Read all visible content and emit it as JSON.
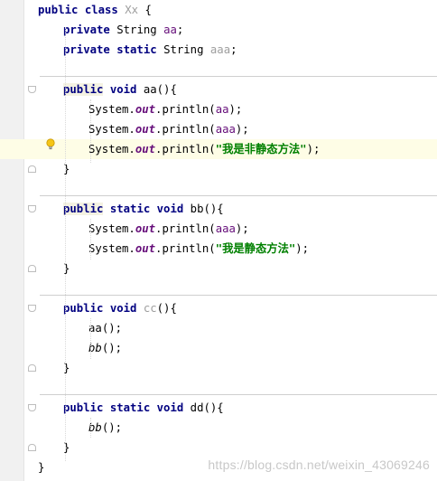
{
  "editor": {
    "lines": [
      {
        "kind": "code",
        "indent": 0,
        "tokens": [
          {
            "t": "public class ",
            "c": "kw"
          },
          {
            "t": "Xx",
            "c": "field-unused"
          },
          {
            "t": " {",
            "c": ""
          }
        ]
      },
      {
        "kind": "code",
        "indent": 1,
        "tokens": [
          {
            "t": "private ",
            "c": "kw"
          },
          {
            "t": "String ",
            "c": ""
          },
          {
            "t": "aa",
            "c": "field"
          },
          {
            "t": ";",
            "c": ""
          }
        ]
      },
      {
        "kind": "code",
        "indent": 1,
        "tokens": [
          {
            "t": "private static ",
            "c": "kw"
          },
          {
            "t": "String ",
            "c": ""
          },
          {
            "t": "aaa",
            "c": "field-unused"
          },
          {
            "t": ";",
            "c": ""
          }
        ]
      },
      {
        "kind": "blank"
      },
      {
        "kind": "code",
        "indent": 1,
        "fold": "start",
        "tokens": [
          {
            "t": "public",
            "c": "kw kwbg"
          },
          {
            "t": " void ",
            "c": "kw"
          },
          {
            "t": "aa",
            "c": ""
          },
          {
            "t": "(){",
            "c": ""
          }
        ]
      },
      {
        "kind": "code",
        "indent": 2,
        "tokens": [
          {
            "t": "System.",
            "c": ""
          },
          {
            "t": "out",
            "c": "static-field"
          },
          {
            "t": ".println(",
            "c": ""
          },
          {
            "t": "aa",
            "c": "field"
          },
          {
            "t": ");",
            "c": ""
          }
        ]
      },
      {
        "kind": "code",
        "indent": 2,
        "tokens": [
          {
            "t": "System.",
            "c": ""
          },
          {
            "t": "out",
            "c": "static-field"
          },
          {
            "t": ".println(",
            "c": ""
          },
          {
            "t": "aaa",
            "c": "field"
          },
          {
            "t": ");",
            "c": ""
          }
        ]
      },
      {
        "kind": "code",
        "indent": 2,
        "highlight": true,
        "bulb": true,
        "tokens": [
          {
            "t": "System.",
            "c": ""
          },
          {
            "t": "out",
            "c": "static-field"
          },
          {
            "t": ".println(",
            "c": ""
          },
          {
            "t": "\"我是非静态方法\"",
            "c": "str"
          },
          {
            "t": ");",
            "c": ""
          }
        ]
      },
      {
        "kind": "code",
        "indent": 1,
        "fold": "end",
        "tokens": [
          {
            "t": "}",
            "c": ""
          }
        ]
      },
      {
        "kind": "blank"
      },
      {
        "kind": "code",
        "indent": 1,
        "fold": "start",
        "tokens": [
          {
            "t": "public",
            "c": "kw kwbg"
          },
          {
            "t": " static void ",
            "c": "kw"
          },
          {
            "t": "bb",
            "c": ""
          },
          {
            "t": "(){",
            "c": ""
          }
        ]
      },
      {
        "kind": "code",
        "indent": 2,
        "tokens": [
          {
            "t": "System.",
            "c": ""
          },
          {
            "t": "out",
            "c": "static-field"
          },
          {
            "t": ".println(",
            "c": ""
          },
          {
            "t": "aaa",
            "c": "field"
          },
          {
            "t": ");",
            "c": ""
          }
        ]
      },
      {
        "kind": "code",
        "indent": 2,
        "tokens": [
          {
            "t": "System.",
            "c": ""
          },
          {
            "t": "out",
            "c": "static-field"
          },
          {
            "t": ".println(",
            "c": ""
          },
          {
            "t": "\"我是静态方法\"",
            "c": "str"
          },
          {
            "t": ");",
            "c": ""
          }
        ]
      },
      {
        "kind": "code",
        "indent": 1,
        "fold": "end",
        "tokens": [
          {
            "t": "}",
            "c": ""
          }
        ]
      },
      {
        "kind": "blank"
      },
      {
        "kind": "code",
        "indent": 1,
        "fold": "start",
        "tokens": [
          {
            "t": "public void ",
            "c": "kw"
          },
          {
            "t": "cc",
            "c": "method-unused"
          },
          {
            "t": "(){",
            "c": ""
          }
        ]
      },
      {
        "kind": "code",
        "indent": 2,
        "tokens": [
          {
            "t": "aa",
            "c": ""
          },
          {
            "t": "();",
            "c": ""
          }
        ]
      },
      {
        "kind": "code",
        "indent": 2,
        "tokens": [
          {
            "t": "bb",
            "c": "static-call"
          },
          {
            "t": "();",
            "c": ""
          }
        ]
      },
      {
        "kind": "code",
        "indent": 1,
        "fold": "end",
        "tokens": [
          {
            "t": "}",
            "c": ""
          }
        ]
      },
      {
        "kind": "blank"
      },
      {
        "kind": "code",
        "indent": 1,
        "fold": "start",
        "tokens": [
          {
            "t": "public static void ",
            "c": "kw"
          },
          {
            "t": "dd",
            "c": ""
          },
          {
            "t": "(){",
            "c": ""
          }
        ]
      },
      {
        "kind": "code",
        "indent": 2,
        "tokens": [
          {
            "t": "bb",
            "c": "static-call"
          },
          {
            "t": "();",
            "c": ""
          }
        ]
      },
      {
        "kind": "code",
        "indent": 1,
        "fold": "end",
        "tokens": [
          {
            "t": "}",
            "c": ""
          }
        ]
      },
      {
        "kind": "code",
        "indent": 0,
        "tokens": [
          {
            "t": "}",
            "c": ""
          }
        ]
      }
    ]
  },
  "watermark": "https://blog.csdn.net/weixin_43069246",
  "colors": {
    "keyword": "#000080",
    "field": "#660e7a",
    "unused": "#9e9e9e",
    "string": "#008000",
    "highlight": "#fefde6",
    "bulb": "#f0b400"
  }
}
